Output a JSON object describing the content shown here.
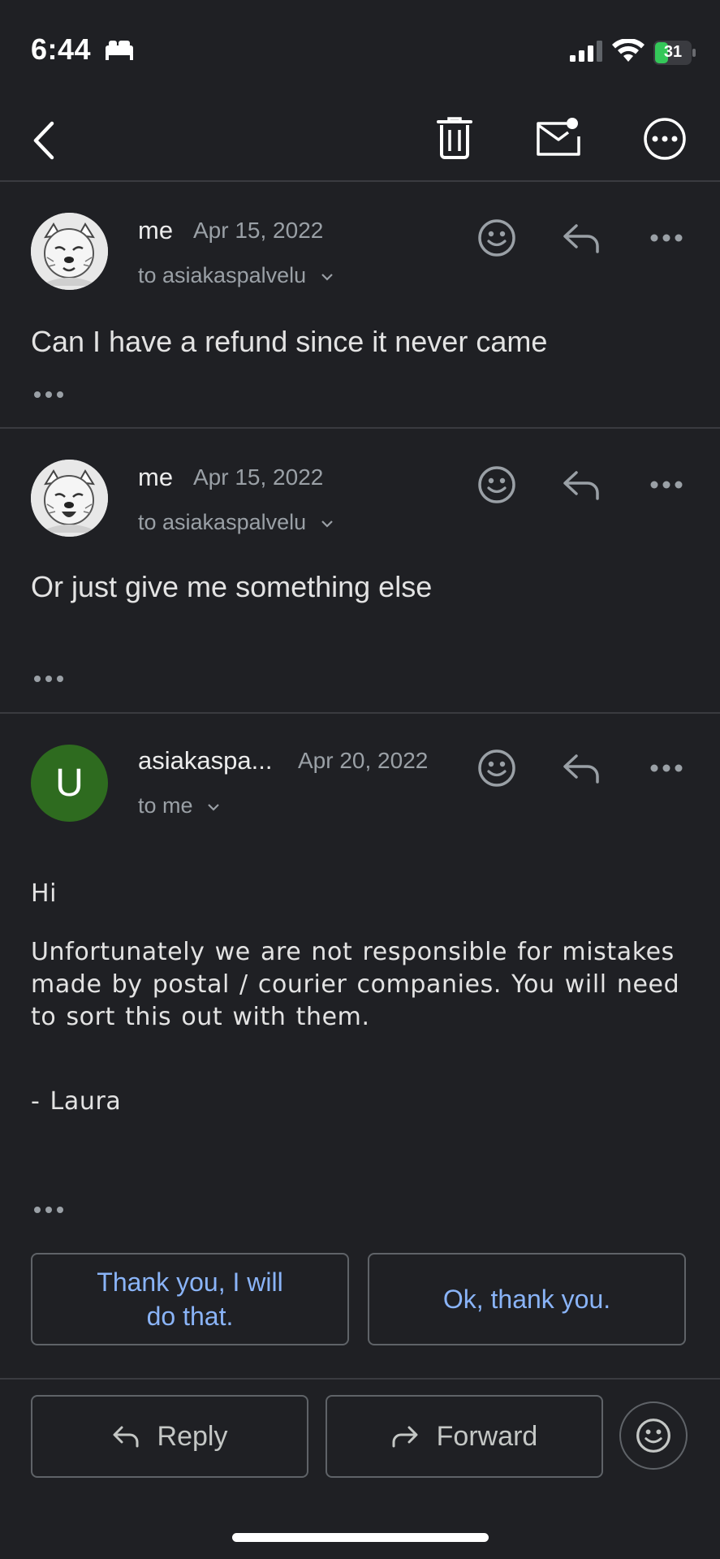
{
  "status": {
    "time": "6:44",
    "battery": "31"
  },
  "toolbar": {
    "back_icon": "chevron-left-icon",
    "delete_icon": "trash-icon",
    "mark_unread_icon": "mail-unread-icon",
    "more_icon": "more-circle-icon"
  },
  "messages": [
    {
      "sender": "me",
      "date": "Apr 15, 2022",
      "recipient": "to asiakaspalvelu",
      "body": "Can I have a refund since it never came"
    },
    {
      "sender": "me",
      "date": "Apr 15, 2022",
      "recipient": "to asiakaspalvelu",
      "body": "Or just give me something else"
    },
    {
      "sender": "asiakaspa...",
      "avatar_letter": "U",
      "date": "Apr 20, 2022",
      "recipient": "to me",
      "body_lines": [
        "Hi",
        "Unfortunately we are not responsible for mistakes made by postal / courier companies. You will need to sort this out with them.",
        "- Laura"
      ]
    }
  ],
  "smart_replies": [
    "Thank you, I will do that.",
    "Ok, thank you."
  ],
  "actions": {
    "reply": "Reply",
    "forward": "Forward"
  },
  "colors": {
    "background": "#1f2024",
    "accent_link": "#8ab4f8",
    "avatar_green": "#2e6b1f"
  }
}
